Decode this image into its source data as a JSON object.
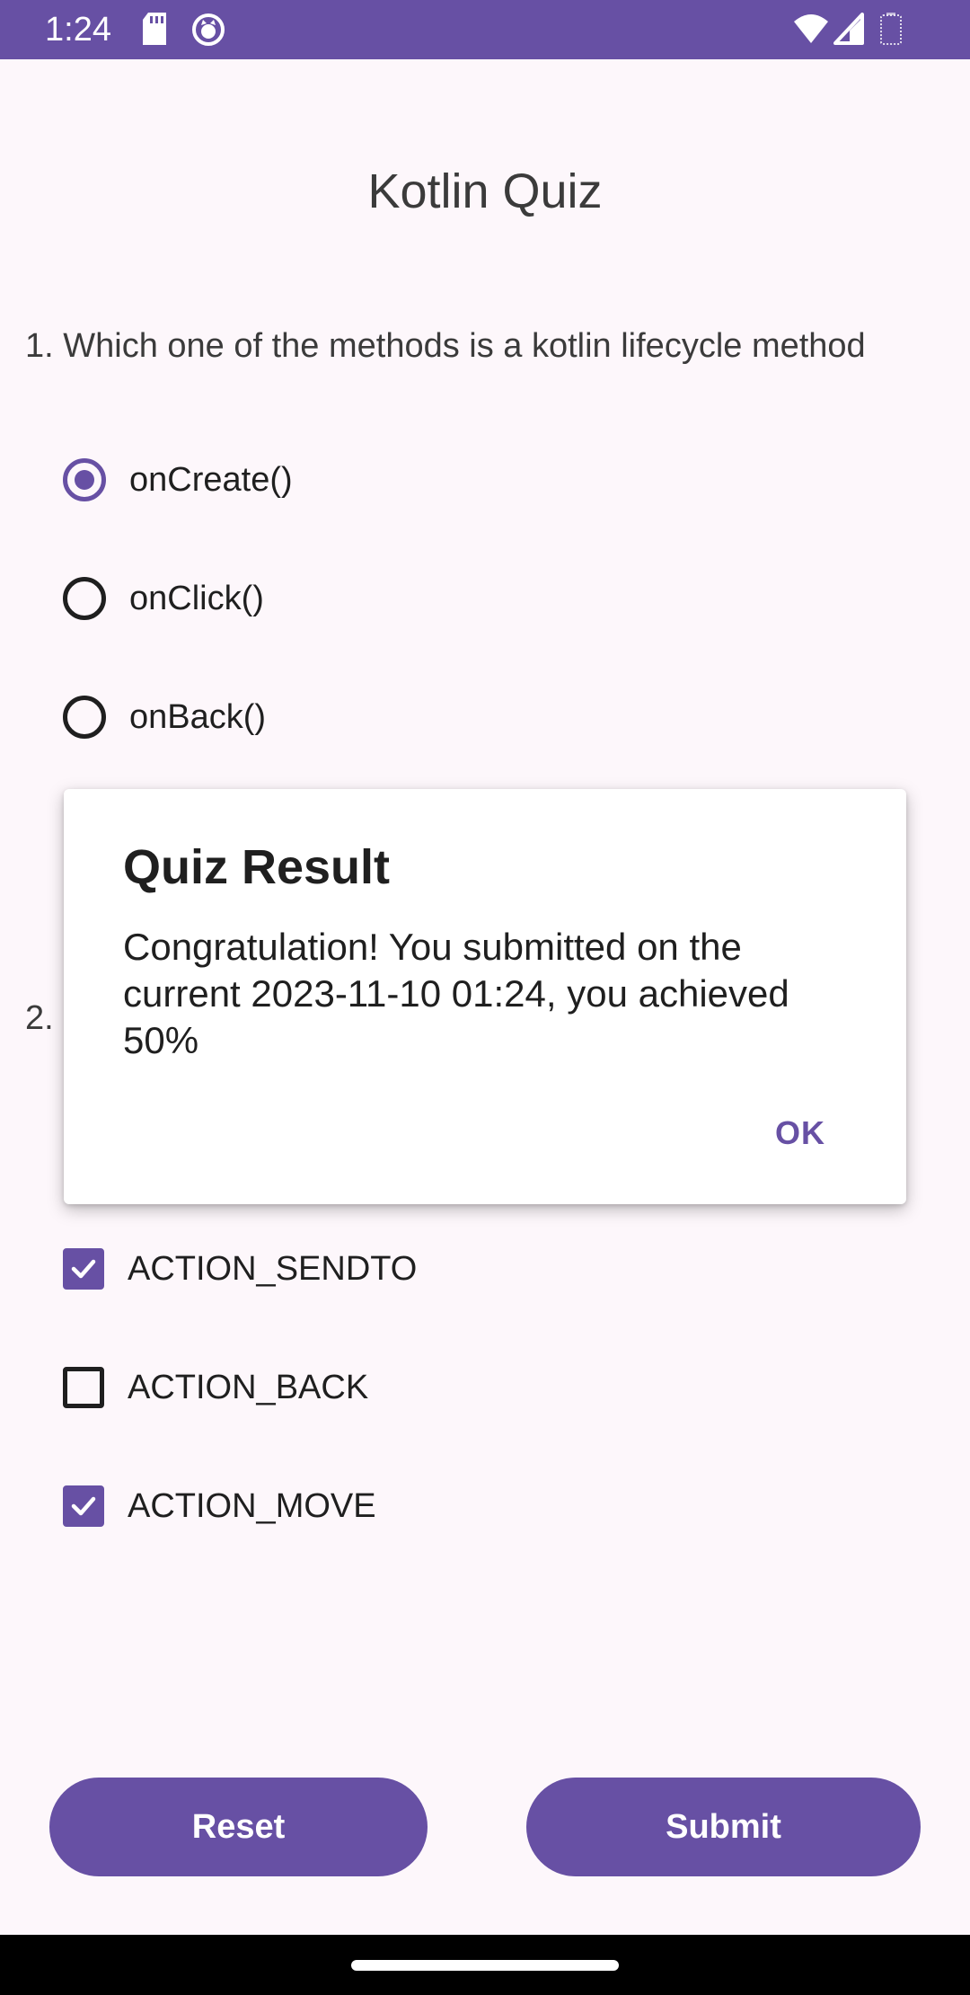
{
  "status_bar": {
    "time": "1:24",
    "left_icons": [
      "sd-card-icon",
      "app-notification-icon"
    ],
    "right_icons": [
      "wifi-icon",
      "signal-icon",
      "battery-icon"
    ]
  },
  "app": {
    "title": "Kotlin Quiz"
  },
  "question1": {
    "text": "1. Which one of the methods is a kotlin lifecycle method",
    "options": [
      {
        "label": "onCreate()",
        "selected": true
      },
      {
        "label": "onClick()",
        "selected": false
      },
      {
        "label": "onBack()",
        "selected": false
      }
    ]
  },
  "question2": {
    "number": "2.",
    "options": [
      {
        "label": "ACTION_SENDTO",
        "checked": true
      },
      {
        "label": "ACTION_BACK",
        "checked": false
      },
      {
        "label": "ACTION_MOVE",
        "checked": true
      }
    ]
  },
  "buttons": {
    "reset": "Reset",
    "submit": "Submit"
  },
  "dialog": {
    "title": "Quiz Result",
    "message": "Congratulation! You submitted on the current 2023-11-10 01:24, you achieved 50%",
    "ok": "OK"
  },
  "colors": {
    "primary": "#6750a4",
    "background": "#fdf7fb",
    "nav_bar": "#000000"
  }
}
